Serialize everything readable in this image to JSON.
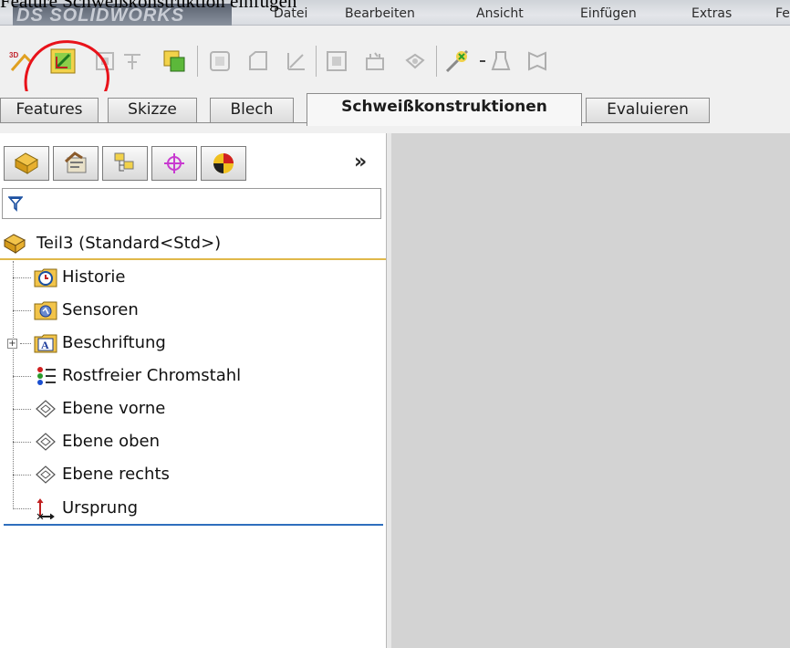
{
  "page_caption": "Feature Schweißkonstruktion einfügen",
  "app": {
    "logo_text": "DS SOLIDWORKS"
  },
  "menu": {
    "items": [
      {
        "label": "Datei"
      },
      {
        "label": "Bearbeiten"
      },
      {
        "label": "Ansicht"
      },
      {
        "label": "Einfügen"
      },
      {
        "label": "Extras"
      },
      {
        "label": "Fe"
      }
    ]
  },
  "toolbar": {
    "icons": [
      "3d-sketch-icon",
      "weldment-icon",
      "structural-member-icon",
      "trim-extend-icon",
      "end-cap-icon",
      "gusset-icon",
      "fillet-bead-icon",
      "weldment-cut-list-icon",
      "extruded-boss-icon",
      "extruded-cut-icon",
      "hole-icon",
      "chamfer-icon",
      "fillet-icon",
      "plane-icon",
      "dropdown-arrow-icon",
      "cosmetic-thread-icon",
      "face-icon"
    ],
    "highlighted_icon": "weldment-icon",
    "annotation_color": "#e8121a"
  },
  "command_tabs": [
    {
      "label": "Features",
      "active": false
    },
    {
      "label": "Skizze",
      "active": false
    },
    {
      "label": "Blech",
      "active": false
    },
    {
      "label": "Schweißkonstruktionen",
      "active": true
    },
    {
      "label": "Evaluieren",
      "active": false
    }
  ],
  "manager_tabs": [
    {
      "icon": "featuremanager-tree-icon"
    },
    {
      "icon": "propertymanager-icon"
    },
    {
      "icon": "configurationmanager-icon"
    },
    {
      "icon": "dimxpert-manager-icon"
    },
    {
      "icon": "display-manager-icon"
    }
  ],
  "manager_expand_label": "»",
  "tree": {
    "root": {
      "label": "Teil3  (Standard<Std>)",
      "icon": "part-icon"
    },
    "items": [
      {
        "label": "Historie",
        "icon": "history-icon",
        "expandable": false
      },
      {
        "label": "Sensoren",
        "icon": "sensors-icon",
        "expandable": false
      },
      {
        "label": "Beschriftung",
        "icon": "annotations-icon",
        "expandable": true,
        "expander_symbol": "+"
      },
      {
        "label": "Rostfreier Chromstahl",
        "icon": "material-icon",
        "expandable": false
      },
      {
        "label": "Ebene vorne",
        "icon": "plane-icon",
        "expandable": false
      },
      {
        "label": "Ebene oben",
        "icon": "plane-icon",
        "expandable": false
      },
      {
        "label": "Ebene rechts",
        "icon": "plane-icon",
        "expandable": false
      },
      {
        "label": "Ursprung",
        "icon": "origin-icon",
        "expandable": false
      }
    ]
  },
  "colors": {
    "viewport": "#d3d3d3",
    "root_underline": "#e0b84a",
    "tree_end_line": "#2f6fbd"
  }
}
